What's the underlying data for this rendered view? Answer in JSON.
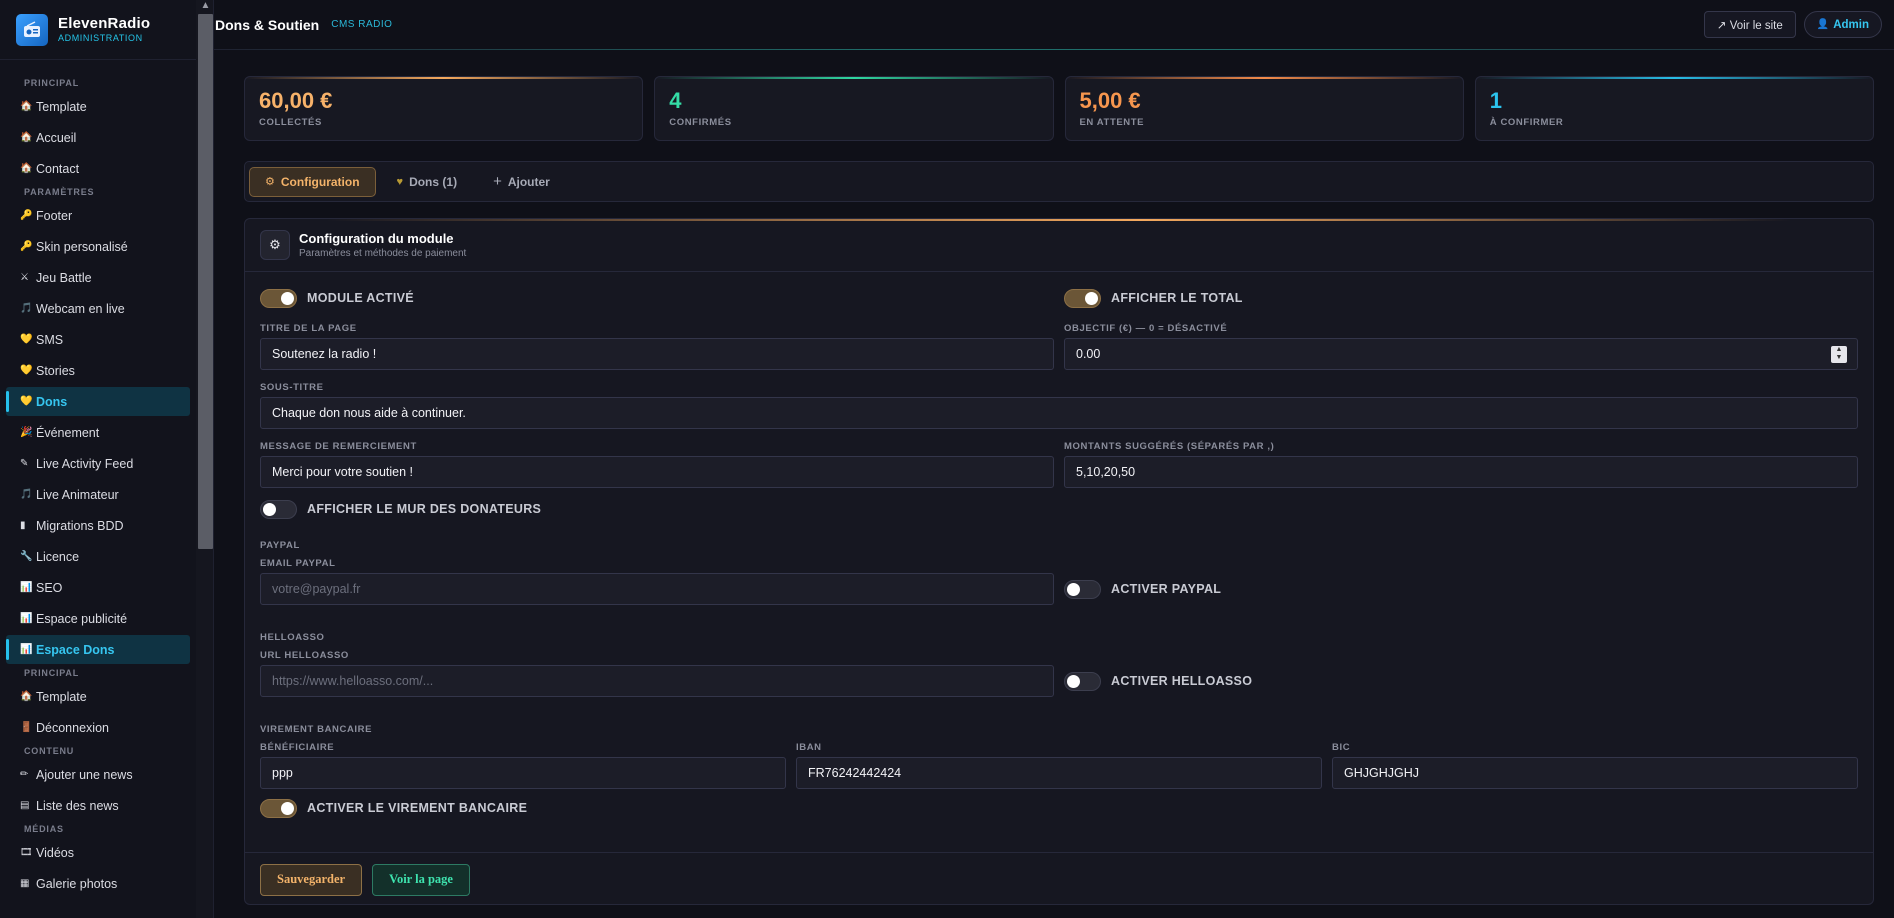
{
  "brand": {
    "name": "ElevenRadio",
    "sub": "ADMINISTRATION"
  },
  "sidebar": {
    "groups": [
      {
        "section": "PRINCIPAL",
        "items": [
          {
            "icon": "🏠",
            "label": "Template"
          },
          {
            "icon": "🏠",
            "label": "Accueil"
          },
          {
            "icon": "🏠",
            "label": "Contact"
          }
        ]
      },
      {
        "section": "PARAMÈTRES",
        "items": [
          {
            "icon": "🔑",
            "label": "Footer"
          },
          {
            "icon": "🔑",
            "label": "Skin personalisé"
          },
          {
            "icon": "⚔",
            "label": "Jeu Battle"
          },
          {
            "icon": "🎵",
            "label": "Webcam en live"
          },
          {
            "icon": "💛",
            "label": "SMS"
          },
          {
            "icon": "💛",
            "label": "Stories"
          },
          {
            "icon": "💛",
            "label": "Dons"
          },
          {
            "icon": "🎉",
            "label": "Événement"
          },
          {
            "icon": "✎",
            "label": "Live Activity Feed"
          },
          {
            "icon": "🎵",
            "label": "Live Animateur"
          },
          {
            "icon": "▮",
            "label": "Migrations BDD"
          },
          {
            "icon": "🔧",
            "label": "Licence"
          },
          {
            "icon": "📊",
            "label": "SEO"
          },
          {
            "icon": "📊",
            "label": "Espace publicité"
          },
          {
            "icon": "📊",
            "label": "Espace Dons"
          }
        ]
      },
      {
        "section": "PRINCIPAL",
        "items": [
          {
            "icon": "🏠",
            "label": "Template"
          },
          {
            "icon": "🚪",
            "label": "Déconnexion"
          }
        ]
      },
      {
        "section": "CONTENU",
        "items": [
          {
            "icon": "✏",
            "label": "Ajouter une news"
          },
          {
            "icon": "▤",
            "label": "Liste des news"
          }
        ]
      },
      {
        "section": "MÉDIAS",
        "items": [
          {
            "icon": "🎞",
            "label": "Vidéos"
          },
          {
            "icon": "▦",
            "label": "Galerie photos"
          }
        ]
      }
    ],
    "active_items": [
      "Dons",
      "Espace Dons"
    ]
  },
  "topbar": {
    "title": "Dons & Soutien",
    "tag": "CMS RADIO",
    "view_site": "↗ Voir le site",
    "admin": "Admin"
  },
  "stats": [
    {
      "value": "60,00 €",
      "label": "COLLECTÉS",
      "color": "#f7b26a"
    },
    {
      "value": "4",
      "label": "CONFIRMÉS",
      "color": "#34dca6"
    },
    {
      "value": "5,00 €",
      "label": "EN ATTENTE",
      "color": "#f7964e"
    },
    {
      "value": "1",
      "label": "À CONFIRMER",
      "color": "#2cc3ee"
    }
  ],
  "tabs": {
    "config": "Configuration",
    "dons": "Dons (1)",
    "add": "Ajouter"
  },
  "config": {
    "title": "Configuration du module",
    "subtitle": "Paramètres et méthodes de paiement",
    "module_active": {
      "label": "MODULE ACTIVÉ",
      "on": true
    },
    "show_total": {
      "label": "AFFICHER LE TOTAL",
      "on": true
    },
    "page_title": {
      "label": "TITRE DE LA PAGE",
      "value": "Soutenez la radio !"
    },
    "goal": {
      "label": "OBJECTIF (€) — 0 = DÉSACTIVÉ",
      "value": "0.00"
    },
    "subtitle_field": {
      "label": "SOUS-TITRE",
      "value": "Chaque don nous aide à continuer."
    },
    "thanks": {
      "label": "MESSAGE DE REMERCIEMENT",
      "value": "Merci pour votre soutien !"
    },
    "amounts": {
      "label": "MONTANTS SUGGÉRÉS (SÉPARÉS PAR ,)",
      "value": "5,10,20,50"
    },
    "donor_wall": {
      "label": "AFFICHER LE MUR DES DONATEURS",
      "on": false
    },
    "paypal": {
      "section": "PAYPAL",
      "email_label": "EMAIL PAYPAL",
      "email_placeholder": "votre@paypal.fr",
      "toggle_label": "ACTIVER PAYPAL",
      "on": false
    },
    "helloasso": {
      "section": "HELLOASSO",
      "url_label": "URL HELLOASSO",
      "url_placeholder": "https://www.helloasso.com/...",
      "toggle_label": "ACTIVER HELLOASSO",
      "on": false
    },
    "bank": {
      "section": "VIREMENT BANCAIRE",
      "beneficiary_label": "BÉNÉFICIAIRE",
      "beneficiary_value": "ppp",
      "iban_label": "IBAN",
      "iban_value": "FR76242442424",
      "bic_label": "BIC",
      "bic_value": "GHJGHJGHJ",
      "toggle_label": "ACTIVER LE VIREMENT BANCAIRE",
      "on": true
    },
    "save": "Sauvegarder",
    "view_page": "Voir la page"
  }
}
